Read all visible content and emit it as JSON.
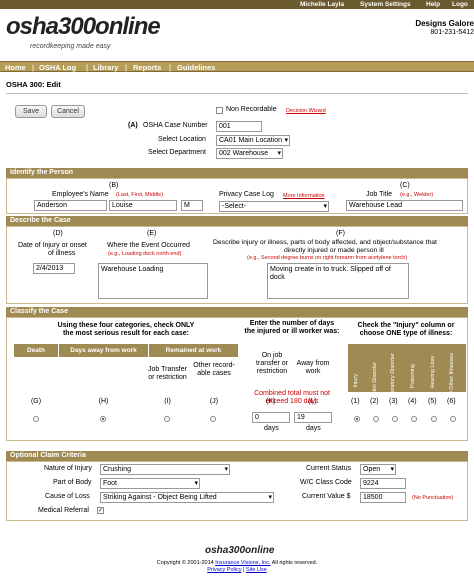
{
  "topbar": {
    "user": "Michelle Layla",
    "system_settings": "System Settings",
    "help": "Help",
    "logout": "Logo"
  },
  "brand": {
    "logo": "osha300online",
    "tagline": "recordkeeping made easy",
    "company": "Designs Galore",
    "phone": "801-231-5412"
  },
  "nav": [
    "Home",
    "OSHA Log",
    "Library",
    "Reports",
    "Guidelines"
  ],
  "page": {
    "title": "OSHA 300: Edit"
  },
  "actions": {
    "save": "Save",
    "cancel": "Cancel"
  },
  "top_fields": {
    "non_recordable": "Non Recordable",
    "decision_wizard": "Decision Wizard",
    "case_letter": "(A)",
    "case_number_label": "OSHA Case Number",
    "case_number": "001",
    "location_label": "Select Location",
    "location": "CA01 Main Location",
    "department_label": "Select Department",
    "department": "002 Warehouse"
  },
  "identify": {
    "section": "Identify the Person",
    "b_letter": "(B)",
    "name_label": "Employee's Name",
    "name_hint": "(Last, First, Middle)",
    "last": "Anderson",
    "first": "Louise",
    "middle": "M",
    "privacy_label": "Privacy Case Log",
    "privacy_link": "More Information",
    "privacy_value": "-Select-",
    "c_letter": "(C)",
    "job_label": "Job Title",
    "job_hint": "(e.g., Welder)",
    "job_value": "Warehouse Lead"
  },
  "describe": {
    "section": "Describe the Case",
    "d_letter": "(D)",
    "date_label_1": "Date of Injury or onset",
    "date_label_2": "of illness",
    "date_value": "2/4/2013",
    "e_letter": "(E)",
    "where_label": "Where the Event Occurred",
    "where_hint": "(e.g., Loading dock north end)",
    "where_value": "Warehouse Loading",
    "f_letter": "(F)",
    "desc_label_1": "Describe injury or illness, parts of body affected, and object/substance that",
    "desc_label_2": "directly injured or made person ill",
    "desc_hint": "(e.g., Second degree burns on right forearm from acetylene torch)",
    "desc_value": "Moving create in to truck. Slipped off of dock"
  },
  "classify": {
    "section": "Classify the Case",
    "left_head_1": "Using these four categories, check ONLY",
    "left_head_2": "the most serious result for each case:",
    "col_death": "Death",
    "col_away": "Days away from work",
    "col_remained": "Remained at work",
    "col_transfer": "Job Transfer or restriction",
    "col_other": "Other record-able cases",
    "g": "(G)",
    "h": "(H)",
    "i": "(I)",
    "j": "(J)",
    "mid_head": "Enter the number of days the injured or ill worker was:",
    "on_job": "On job transfer or restriction",
    "away_from": "Away from work",
    "k": "(K)",
    "l": "(L)",
    "combined_note": "Combined total must not exceed 180 days",
    "days_on_job": "0",
    "days_away": "19",
    "days_unit": "days",
    "right_head": "Check the \"Injury\" column or choose ONE type of illness:",
    "types": [
      "Injury",
      "Skin Disorder",
      "Respiratory Disorder",
      "Poisoning",
      "Hearing Loss",
      "All Other Illnesses"
    ],
    "type_letters": [
      "(1)",
      "(2)",
      "(3)",
      "(4)",
      "(5)",
      "(6)"
    ]
  },
  "optional": {
    "section": "Optional Claim Criteria",
    "nature_label": "Nature of Injury",
    "nature_value": "Crushing",
    "body_label": "Part of Body",
    "body_value": "Foot",
    "cause_label": "Cause of Loss",
    "cause_value": "Striking Against - Object Being Lifted",
    "referral_label": "Medical Referral",
    "status_label": "Current Status",
    "status_value": "Open",
    "wc_label": "W/C Class Code",
    "wc_value": "9224",
    "value_label": "Current Value $",
    "value_value": "18500",
    "no_punct": "(No Punctuation)"
  },
  "footer": {
    "logo": "osha300online",
    "copy_prefix": "Copyright © 2001-2014",
    "company_link": "Insurance Visions, Inc.",
    "copy_suffix": "All rights reserved.",
    "privacy": "Privacy Policy",
    "site_use": "Site Use"
  }
}
